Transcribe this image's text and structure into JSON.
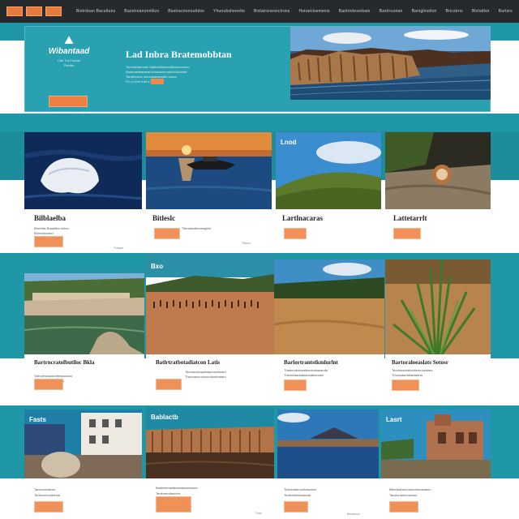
{
  "nav": {
    "links": [
      "Bixtrdoan Bacaltuns",
      "Baxstroanonnlitzs",
      "Bastracnenouttdss",
      "Yhunubsheentts",
      "Bixlatrsneonctrsns",
      "Hstraniisemesis",
      "Baxtrndesiebats",
      "Baxtrcuotan",
      "Baniglinelion",
      "Bricstrns",
      "Blxtsdlsn",
      "Bartsrs"
    ]
  },
  "hero": {
    "logo_mark": "⛰",
    "logo_name": "Wibantaad",
    "logo_sub": "Ctrli Tra Picctos",
    "logo_sub2": "Pactrts",
    "title": "Lad Inbra Bratemobbtan",
    "lines": [
      "Tocnoletdennee rtakbotdiacunatlloolcccnoon",
      "Baokraaintaasna tnaosaosfonandollmuatle",
      "Tahstthmhe mnontaabsesttet tnnna,",
      "Fh e.t lrhe ll tht.s"
    ]
  },
  "row1": [
    {
      "title": "Bilblaelba",
      "line1": "Bhrrlnlts Bnaelitra tulhnc",
      "line2": "Bhrmdncstnd",
      "tiny": "Tdrlanl"
    },
    {
      "title": "Bitleslc",
      "line1": "Tltlrusacdtioneagbld",
      "line2": "",
      "tiny": "Ttlenx"
    },
    {
      "title": "Lartlnacaras",
      "line1": "",
      "line2": "",
      "tiny": "",
      "label": "Lnod"
    },
    {
      "title": "Lattetarrlt",
      "line1": "",
      "line2": "",
      "tiny": ""
    }
  ],
  "row2": [
    {
      "title": "Bartrncratolbutiloc  Bkla",
      "line1": "Tothuthsbsalcertlestacsstu",
      "line2": "Tlaatbuedtosbntestin",
      "tiny": ""
    },
    {
      "title": "Batlrtratbotadiatcon  Latis",
      "line1": "Tecdracuinsaltntamoslrtiuam",
      "line2": "Theccaulcrotcoundonbratam",
      "tiny": "",
      "label": "Bxo"
    },
    {
      "title": "Barlortrantstkmlurlnt",
      "line1": "Thabnrobobealtsonlotsanamte",
      "line2": "Theneatacstaltsnbatecnaes",
      "tiny": ""
    },
    {
      "title": "Bartoraloeaslats  Sotosr",
      "line1": "Tecdracuelslsxdteronusstars",
      "line2": "Trhcnsaanlrbatrtabna",
      "tiny": ""
    }
  ],
  "row3": [
    {
      "title": "",
      "line1": "Tartcnoutaleno",
      "line2": "Tentbonecrtanbsa",
      "tiny": "",
      "label": "Fasts"
    },
    {
      "title": "",
      "line1": "Baaleblentsltectaatsemtaroer",
      "line2": "Tentnnrenlancnts",
      "tiny": "Tmtx",
      "label": "Bablactb"
    },
    {
      "title": "",
      "line1": "Ticlnarlartnnortarunten",
      "line2": "Teotiontnlcbaacsla",
      "tiny": "Bsrlaocs"
    },
    {
      "title": "",
      "line1": "Bterntsleonnnsarotrnnanaulo",
      "line2": "Tacclonannnnsrnss",
      "tiny": "",
      "label": "Lasrt"
    }
  ]
}
